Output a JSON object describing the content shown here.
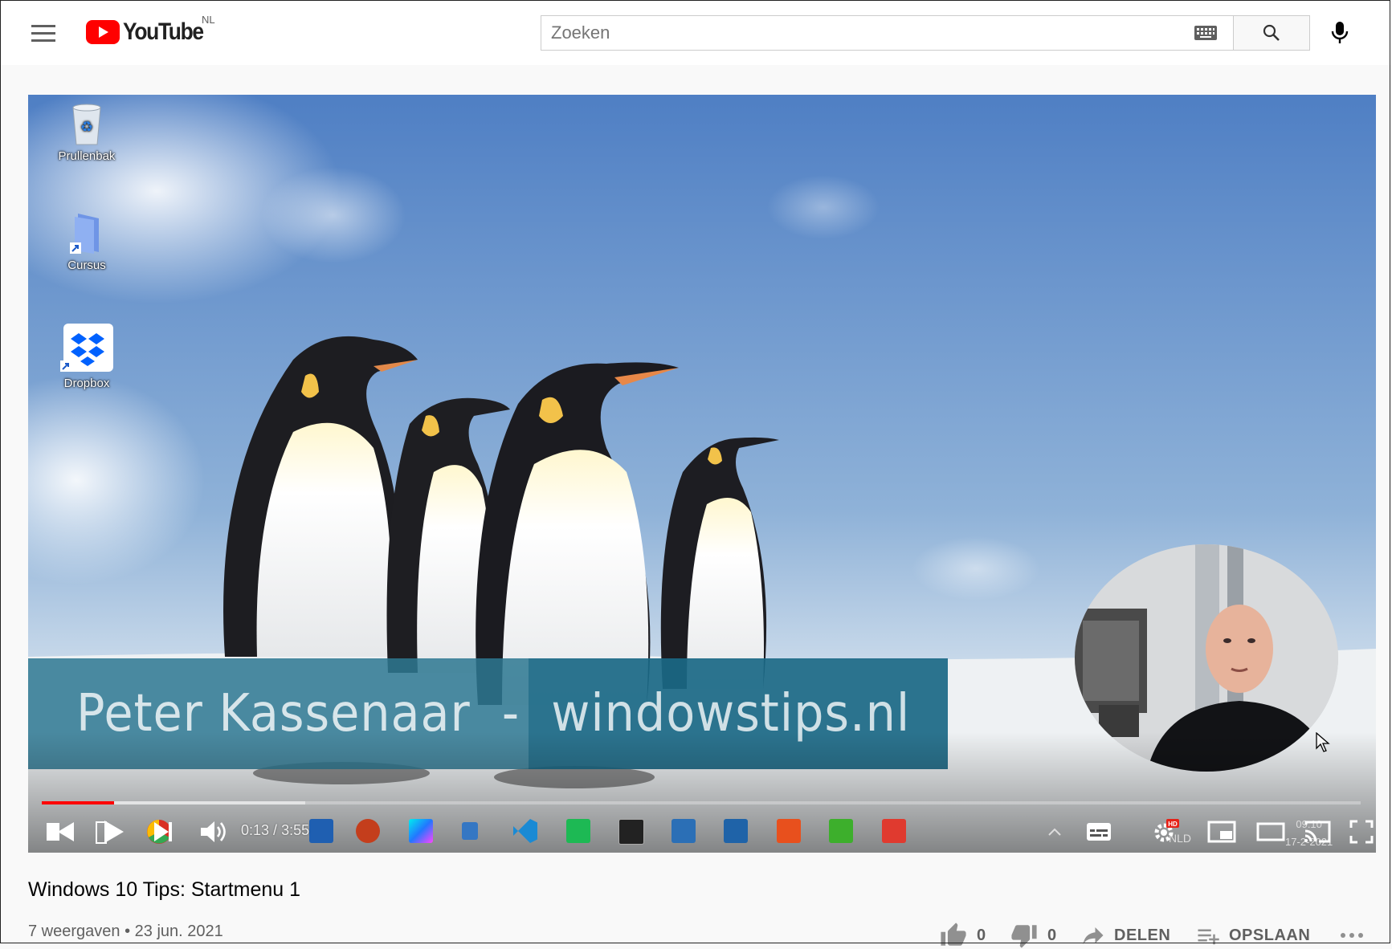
{
  "header": {
    "logo_text": "YouTube",
    "country_code": "NL",
    "search_placeholder": "Zoeken"
  },
  "video": {
    "desktop_icons": [
      {
        "label": "Prullenbak",
        "icon": "recycle-bin-icon"
      },
      {
        "label": "Cursus",
        "icon": "folder-shortcut-icon"
      },
      {
        "label": "Dropbox",
        "icon": "dropbox-icon"
      }
    ],
    "overlay_left": "Peter Kassenaar  -",
    "overlay_right": "windowstips.nl",
    "time_current": "0:13",
    "time_separator": " / ",
    "time_total": "3:55",
    "progress_played_fraction": 0.055,
    "progress_loaded_fraction": 0.2,
    "embedded_taskbar": {
      "lang": "NLD",
      "clock_time": "09:10",
      "clock_date": "17-2-2021"
    }
  },
  "info": {
    "title": "Windows 10 Tips: Startmenu 1",
    "views": "7 weergaven",
    "separator": " • ",
    "date": "23 jun. 2021",
    "likes": "0",
    "dislikes": "0",
    "share_label": "DELEN",
    "save_label": "OPSLAAN"
  },
  "colors": {
    "brand_red": "#ff0000",
    "overlay_teal": "#2d7891",
    "overlay_teal_dark": "#1a6886"
  }
}
